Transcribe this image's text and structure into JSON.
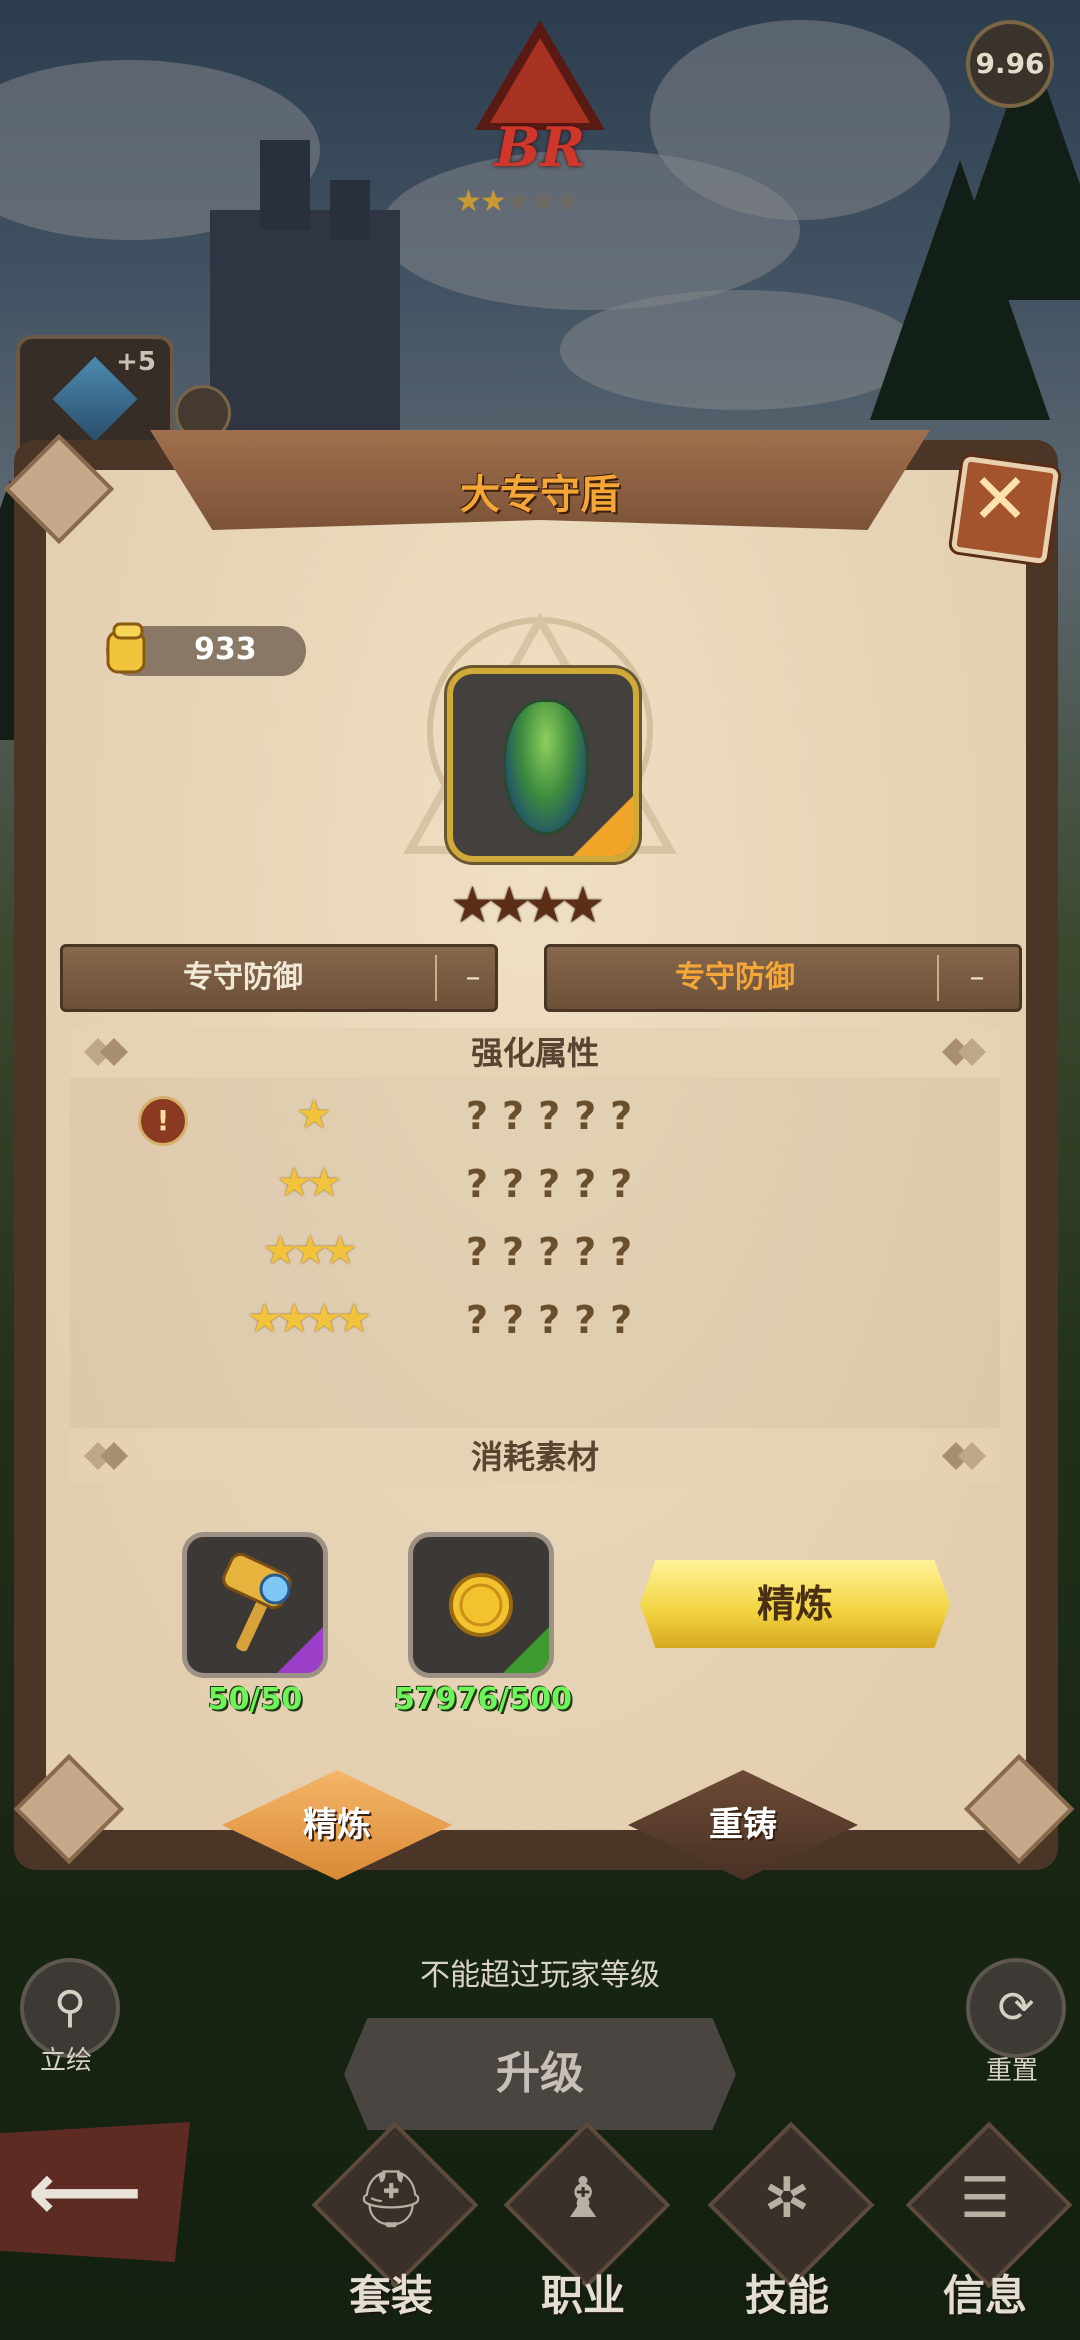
{
  "top": {
    "rank_text": "BR",
    "rank_stars_filled": 2,
    "rank_stars_total": 5,
    "rating": "9.96",
    "slot_plus": "+5"
  },
  "panel": {
    "title": "大专守盾",
    "power": "933",
    "item_stars": 4,
    "exclusive_left": {
      "label": "专守防御",
      "value": "–"
    },
    "exclusive_right": {
      "label": "专守防御",
      "value": "–"
    },
    "attributes_header": "强化属性",
    "attribute_rows": [
      {
        "stars": "★",
        "value": "?????"
      },
      {
        "stars": "★★",
        "value": "?????"
      },
      {
        "stars": "★★★",
        "value": "?????"
      },
      {
        "stars": "★★★★",
        "value": "?????"
      }
    ],
    "materials_header": "消耗素材",
    "materials": [
      {
        "icon": "hammer-icon",
        "count": "50/50",
        "rarity_color": "#9b3fc8"
      },
      {
        "icon": "gold-coin-icon",
        "count": "57976/500",
        "rarity_color": "#3c9a2e"
      }
    ],
    "refine_button": "精炼",
    "tabs": {
      "refine": "精炼",
      "reforge": "重铸"
    }
  },
  "bottom": {
    "hint": "不能超过玩家等级",
    "portrait_label": "立绘",
    "reset_label": "重置",
    "upgrade_button": "升级",
    "nav": [
      "套装",
      "职业",
      "技能",
      "信息"
    ]
  },
  "colors": {
    "accent_gold": "#f4a636",
    "count_green": "#6ef35a",
    "panel_bg": "#e9d7ba",
    "rank_red": "#d0372a"
  }
}
